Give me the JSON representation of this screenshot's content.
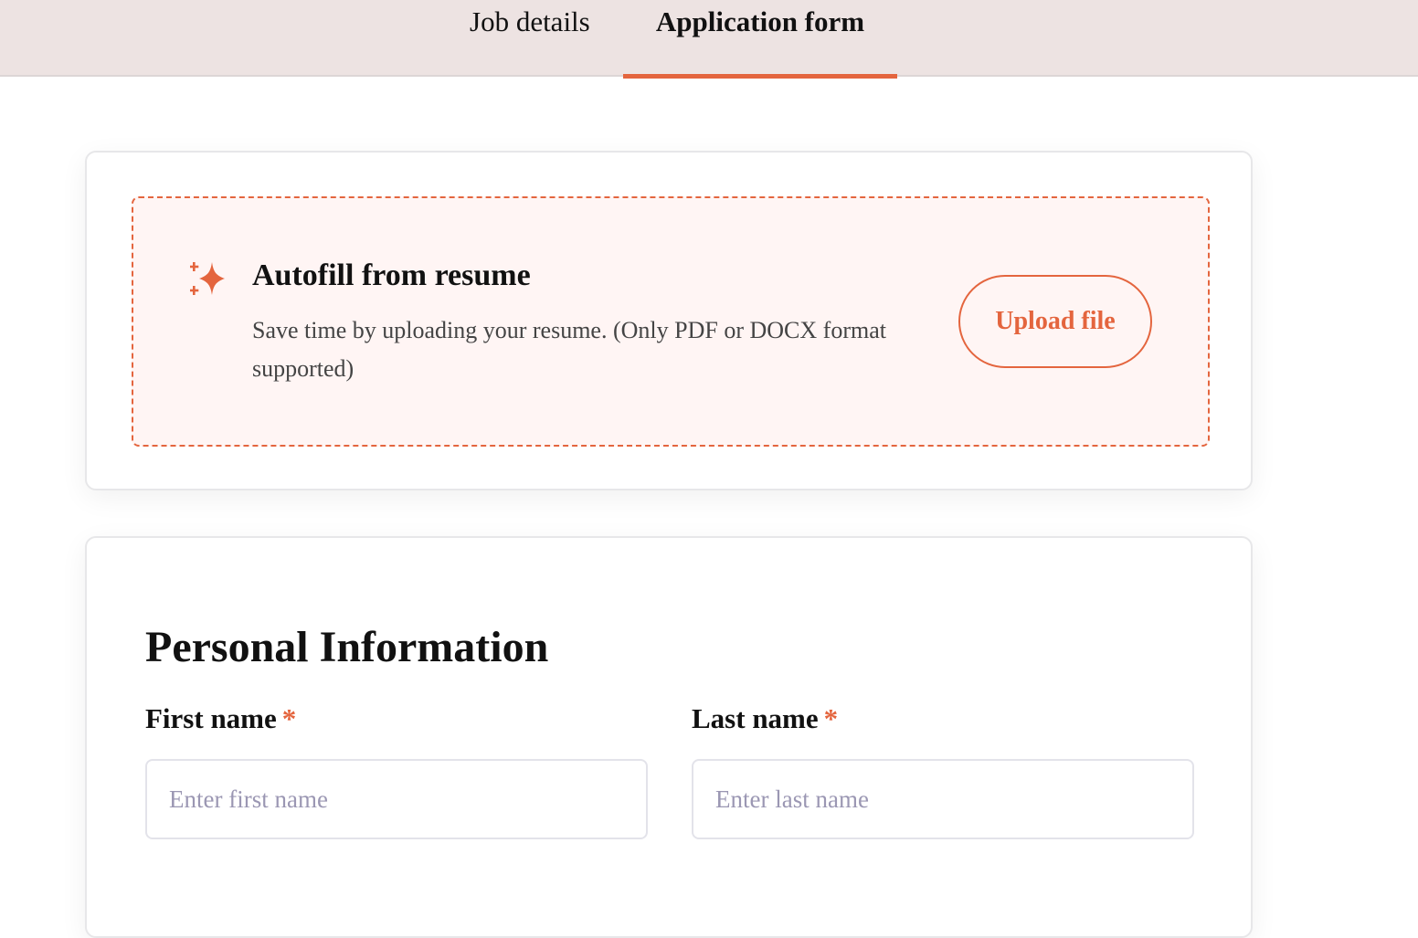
{
  "tabs": [
    {
      "label": "Job details",
      "active": false
    },
    {
      "label": "Application form",
      "active": true
    }
  ],
  "autofill": {
    "icon": "sparkle-icon",
    "title": "Autofill from resume",
    "description": "Save time by uploading your resume. (Only PDF or DOCX format supported)",
    "button_label": "Upload file"
  },
  "personal": {
    "title": "Personal Information",
    "first_name": {
      "label": "First name",
      "required_mark": "*",
      "placeholder": "Enter first name",
      "value": ""
    },
    "last_name": {
      "label": "Last name",
      "required_mark": "*",
      "placeholder": "Enter last name",
      "value": ""
    }
  },
  "colors": {
    "accent": "#e4653e",
    "tabbar_bg": "#ede3e2",
    "autofill_bg": "#fff5f4",
    "placeholder": "#9b97b3"
  }
}
